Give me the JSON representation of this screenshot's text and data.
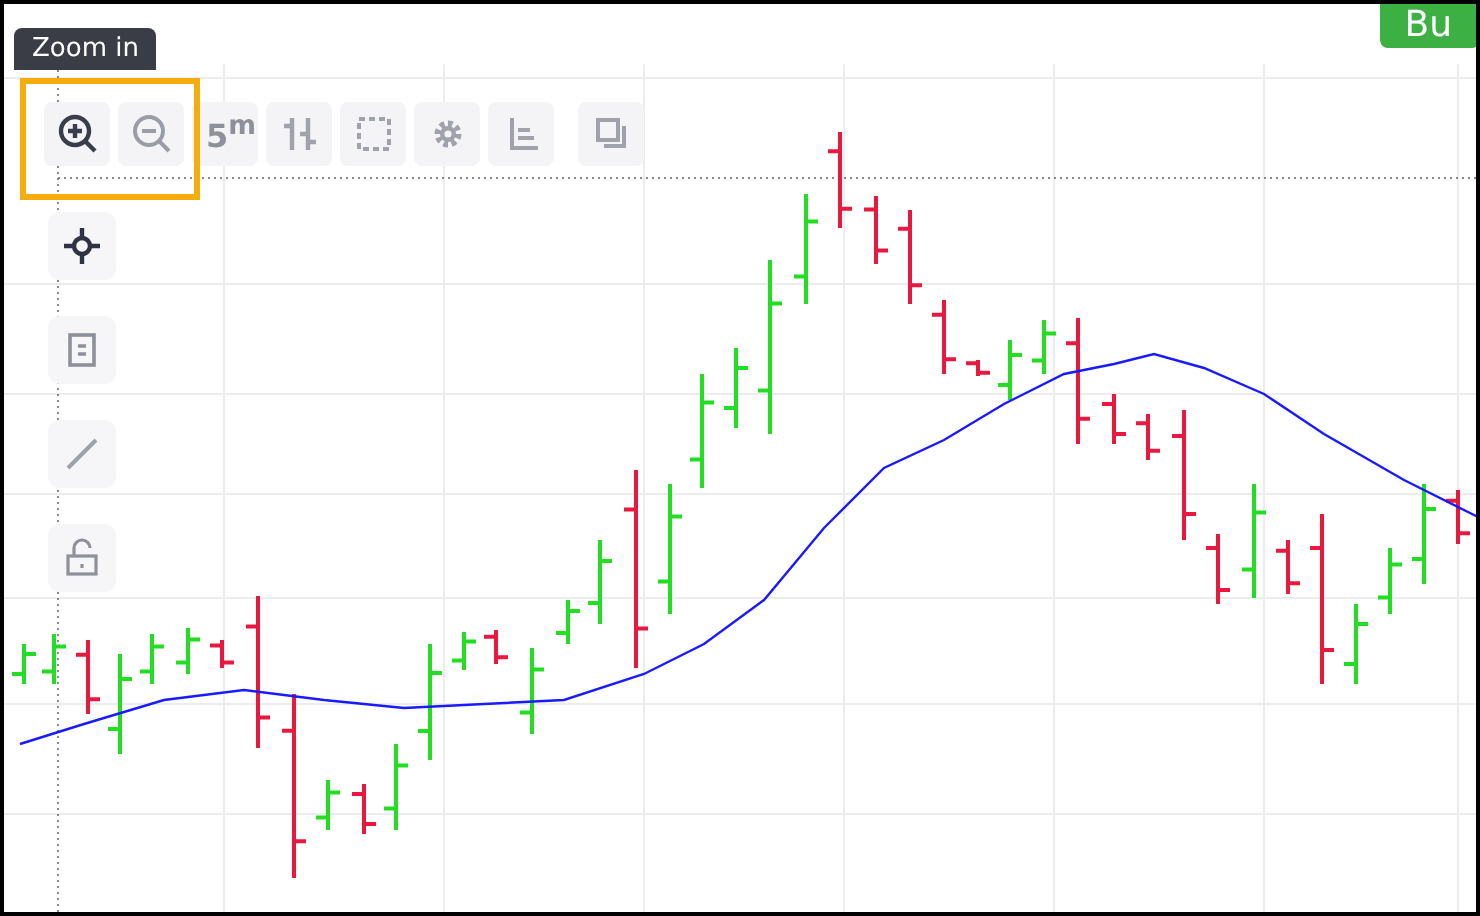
{
  "buy_button": {
    "label": "Bu"
  },
  "tooltip": {
    "text": "Zoom in"
  },
  "interval": {
    "label": "5$^{m}$"
  }
}
